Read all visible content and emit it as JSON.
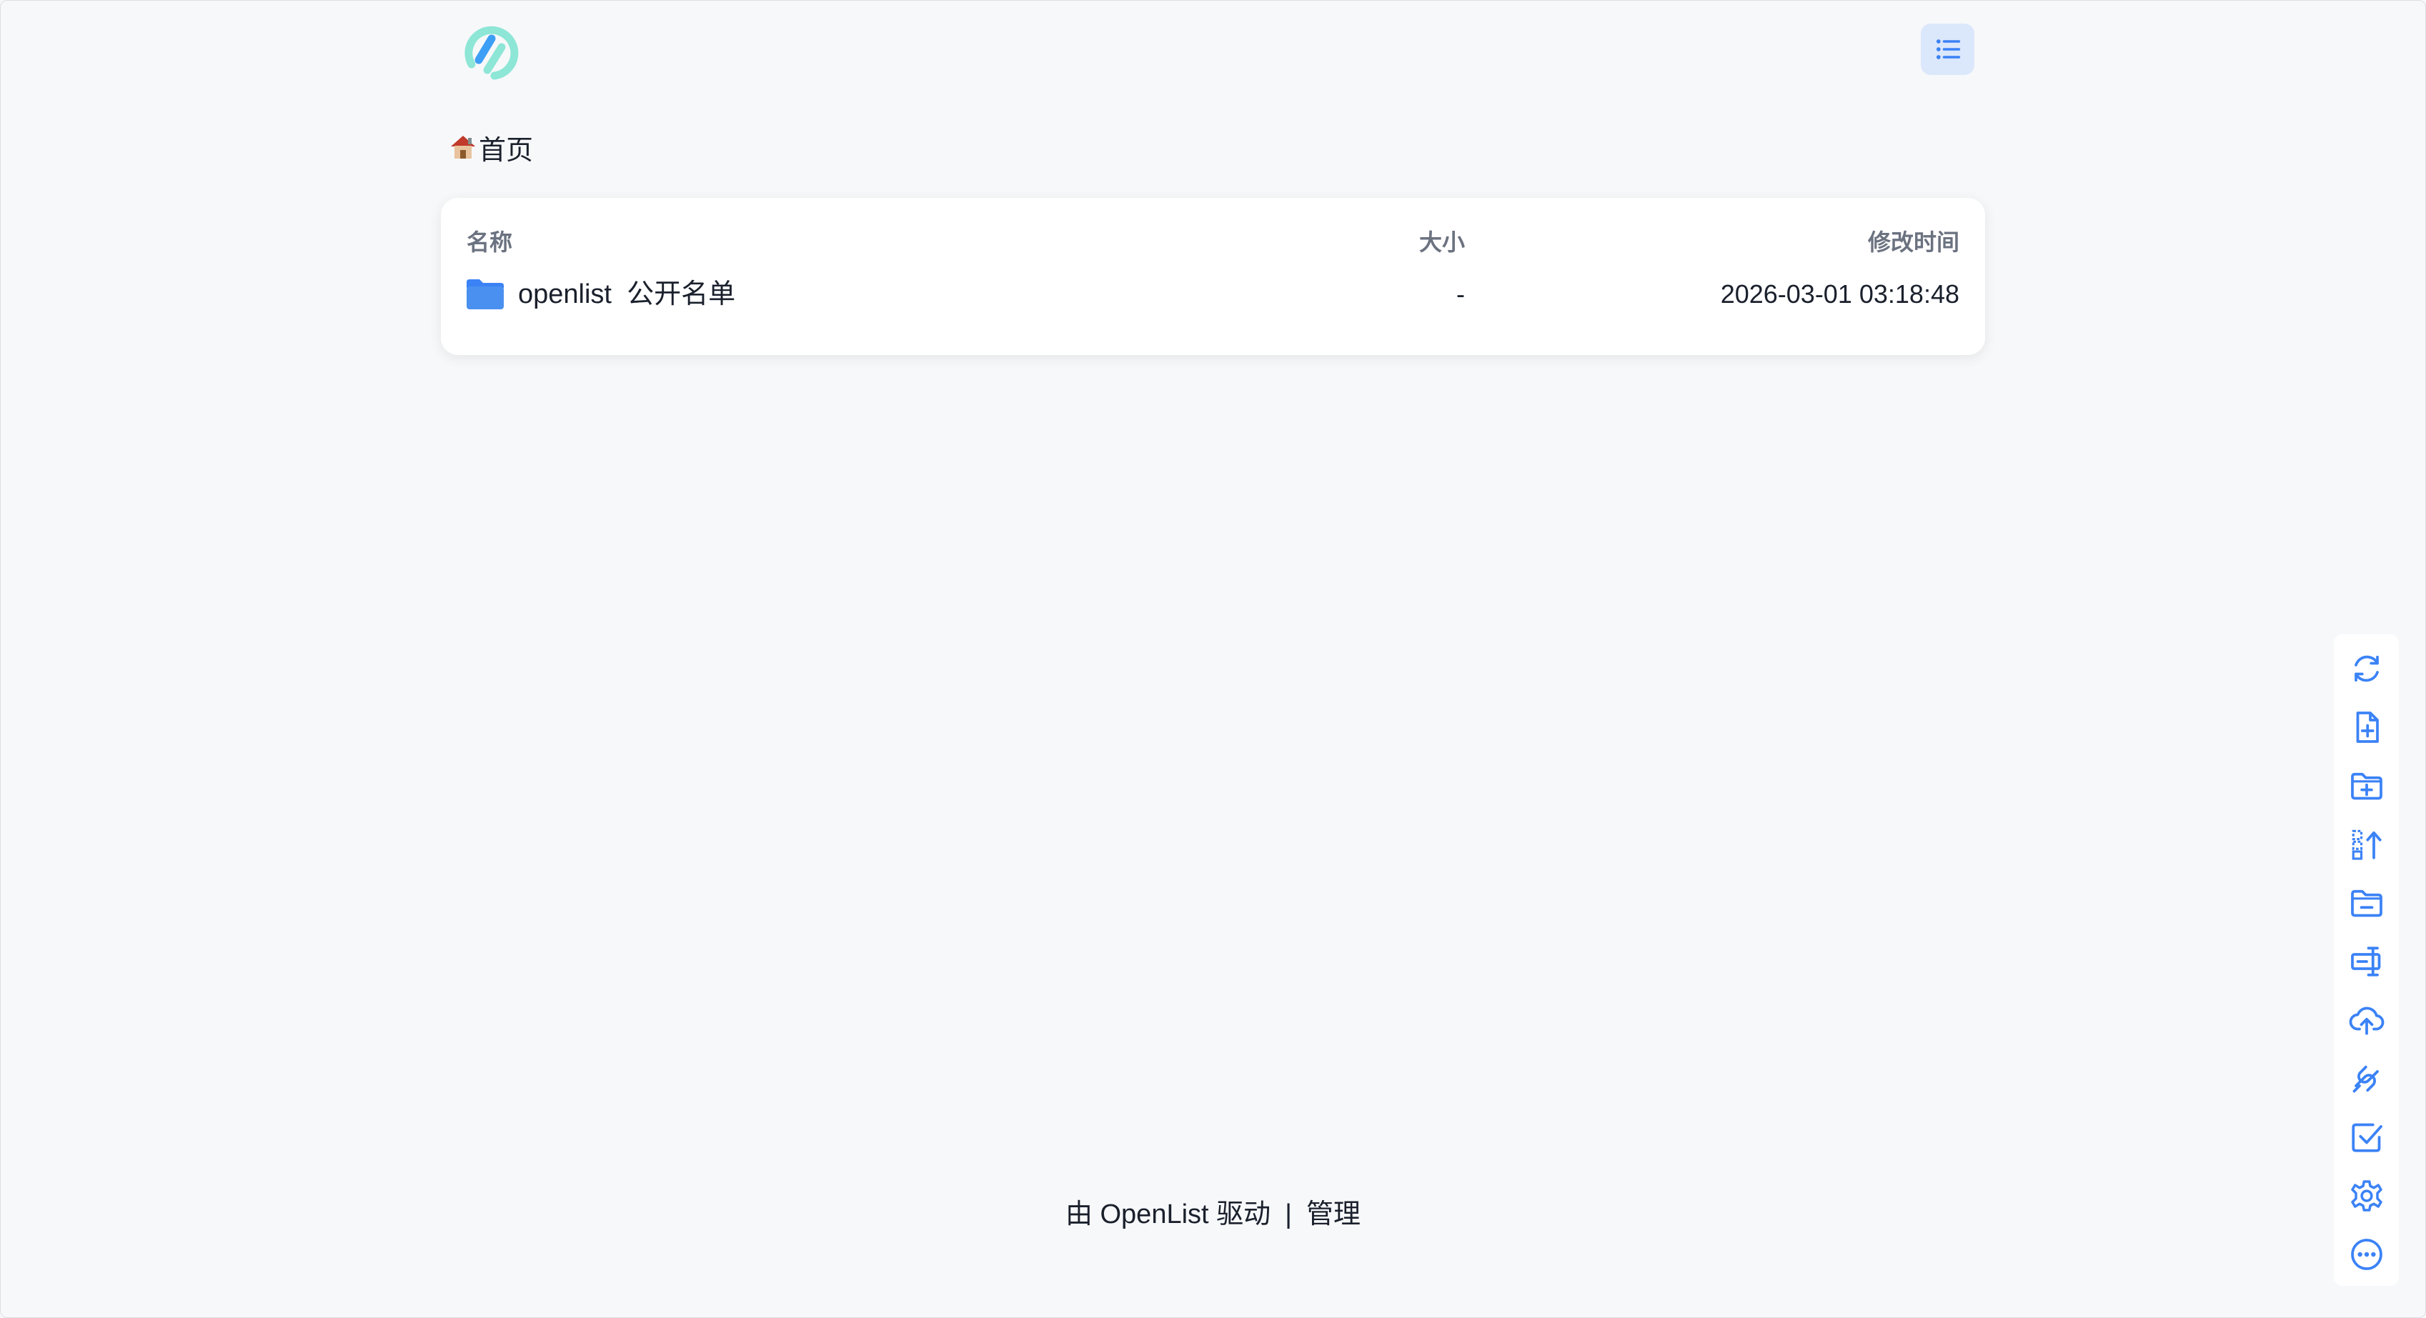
{
  "header": {
    "logo_icon": "openlist-logo-icon",
    "layout_toggle_icon": "list-icon"
  },
  "breadcrumb": {
    "home_icon": "house-icon",
    "home_label": "首页"
  },
  "table": {
    "columns": {
      "name": "名称",
      "size": "大小",
      "modified": "修改时间"
    },
    "rows": [
      {
        "icon": "folder-icon",
        "name": "openlist  公开名单",
        "size": "-",
        "modified": "2026-03-01 03:18:48"
      }
    ]
  },
  "footer": {
    "powered_by": "由 OpenList 驱动",
    "separator": "|",
    "admin": "管理"
  },
  "toolbar": {
    "items": [
      "refresh-icon",
      "new-file-icon",
      "new-folder-icon",
      "sort-upload-icon",
      "folder-minus-icon",
      "rename-icon",
      "cloud-upload-icon",
      "offline-download-link-icon",
      "checkbox-icon",
      "settings-gear-icon",
      "more-icon"
    ]
  },
  "colors": {
    "accent": "#3b82f6",
    "background": "#f7f8fa",
    "card": "#ffffff",
    "header_text": "#6b7280",
    "layout_button_bg": "#dbe7fb",
    "logo_teal": "#7fe0d0",
    "logo_blue": "#4da3f5"
  }
}
